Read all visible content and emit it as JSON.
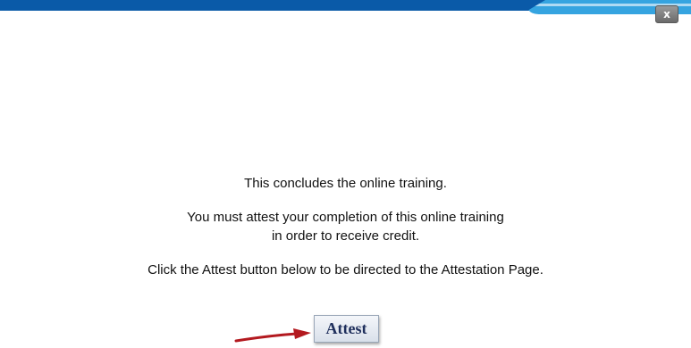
{
  "window": {
    "close_label": "x"
  },
  "colors": {
    "header_blue": "#0a5aa8",
    "header_light_blue": "#35a4e0",
    "arrow_red": "#b3191f",
    "button_text": "#1f2f5c"
  },
  "message": {
    "line1": "This concludes the online training.",
    "line2": "You must attest your completion of this online training",
    "line3": "in order to receive credit.",
    "line4": "Click the Attest button below to be directed to the Attestation Page."
  },
  "actions": {
    "attest_label": "Attest"
  },
  "icons": {
    "close": "close-icon",
    "arrow": "red-arrow-icon"
  }
}
